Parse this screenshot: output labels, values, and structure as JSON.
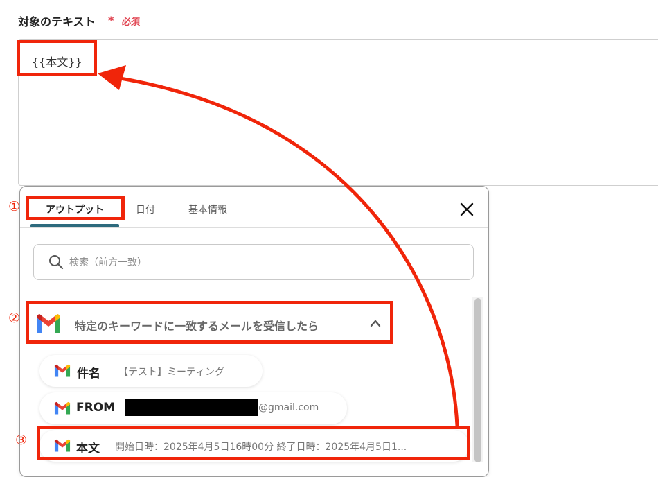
{
  "field": {
    "label": "対象のテキスト",
    "required_star": "*",
    "required_text": "必須",
    "value": "{{本文}}"
  },
  "popup": {
    "tabs": [
      {
        "label": "アウトプット",
        "active": true
      },
      {
        "label": "日付",
        "active": false
      },
      {
        "label": "基本情報",
        "active": false
      }
    ],
    "close_icon": "close-icon",
    "search": {
      "placeholder": "検索（前方一致）",
      "value": ""
    },
    "trigger_group": {
      "label": "特定のキーワードに一致するメールを受信したら",
      "icon": "gmail-icon",
      "expanded": true
    },
    "items": [
      {
        "key": "件名",
        "value": "【テスト】ミーティング"
      },
      {
        "key": "FROM",
        "value": "@gmail.com"
      },
      {
        "key": "本文",
        "value": "開始日時：2025年4月5日16時00分 終了日時：2025年4月5日1..."
      }
    ]
  },
  "annotations": {
    "markers": [
      "①",
      "②",
      "③"
    ],
    "color": "#f0250a"
  },
  "colors": {
    "required": "#e0424f",
    "active_tab_underline": "#2d6a7d"
  }
}
